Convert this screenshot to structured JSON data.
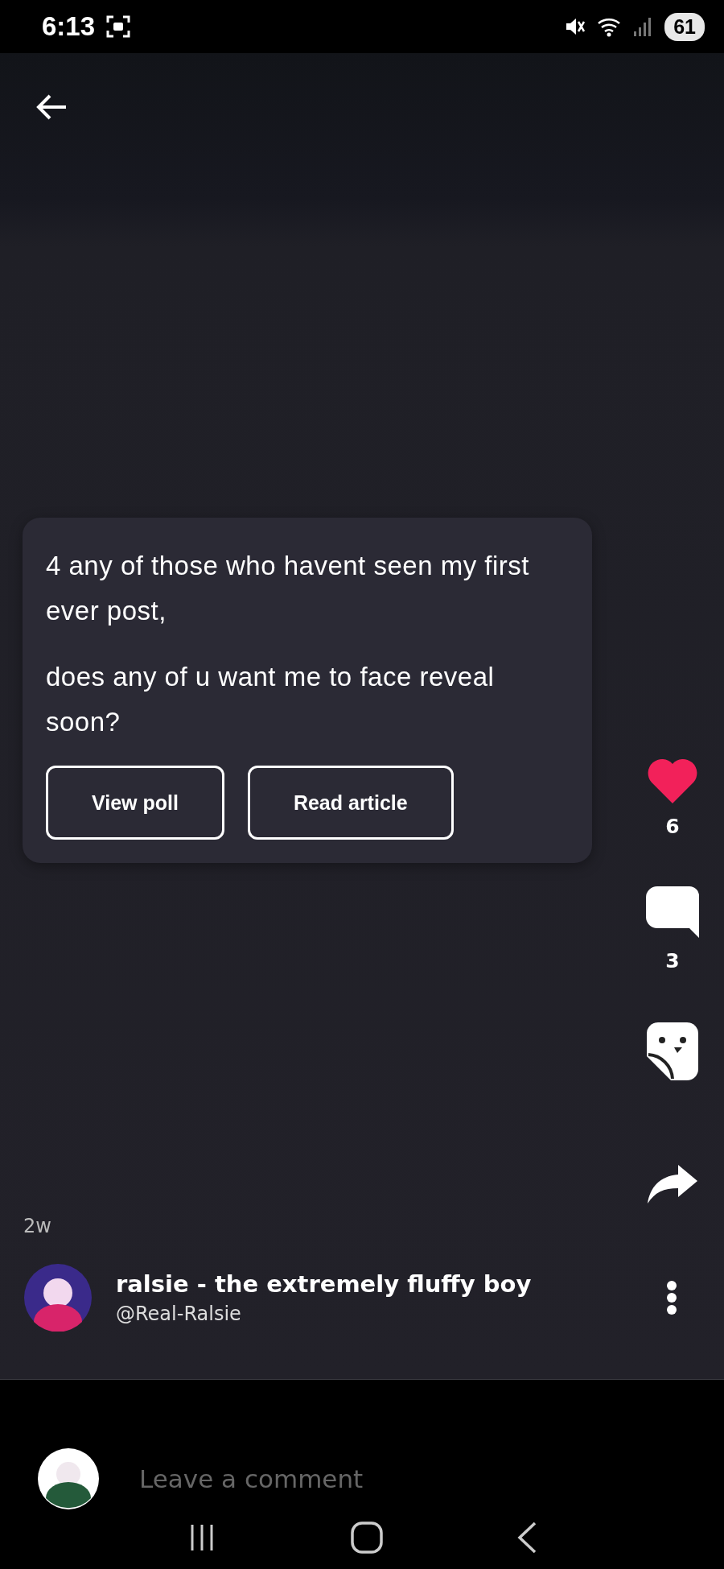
{
  "status_bar": {
    "time": "6:13",
    "battery": "61"
  },
  "post": {
    "paragraphs": [
      "4 any of those who havent seen my first ever post,",
      "does any of u want me to face reveal soon?"
    ],
    "buttons": [
      "View poll",
      "Read article"
    ]
  },
  "actions": [
    {
      "kind": "like",
      "count": "6",
      "liked": true
    },
    {
      "kind": "comment",
      "count": "3"
    },
    {
      "kind": "sticker"
    },
    {
      "kind": "share"
    }
  ],
  "timestamp": "2w",
  "author": {
    "name": "ralsie - the extremely fluffy boy",
    "handle": "@Real-Ralsie"
  },
  "comment_field": {
    "placeholder": "Leave a comment"
  }
}
